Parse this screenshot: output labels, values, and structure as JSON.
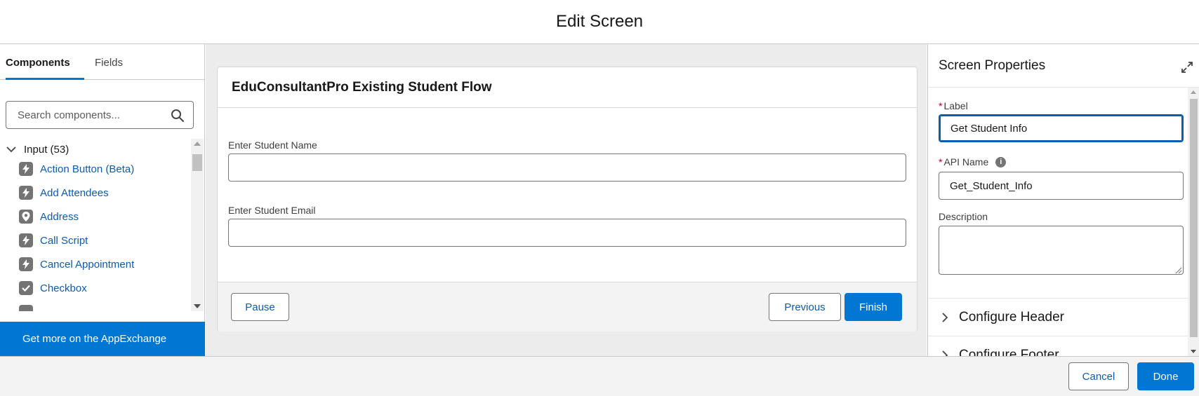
{
  "modal": {
    "title": "Edit Screen"
  },
  "left_panel": {
    "tabs": [
      {
        "label": "Components",
        "active": true
      },
      {
        "label": "Fields",
        "active": false
      }
    ],
    "search": {
      "placeholder": "Search components..."
    },
    "group": {
      "label": "Input (53)",
      "expanded": true
    },
    "components": [
      {
        "label": "Action Button (Beta)",
        "icon": "lightning-icon"
      },
      {
        "label": "Add Attendees",
        "icon": "lightning-icon"
      },
      {
        "label": "Address",
        "icon": "location-pin-icon"
      },
      {
        "label": "Call Script",
        "icon": "lightning-icon"
      },
      {
        "label": "Cancel Appointment",
        "icon": "lightning-icon"
      },
      {
        "label": "Checkbox",
        "icon": "checkbox-icon"
      }
    ],
    "appexchange_label": "Get more on the AppExchange"
  },
  "canvas": {
    "flow_title": "EduConsultantPro Existing Student Flow",
    "fields": [
      {
        "label": "Enter Student Name",
        "value": ""
      },
      {
        "label": "Enter Student Email",
        "value": ""
      }
    ],
    "footer": {
      "pause_label": "Pause",
      "previous_label": "Previous",
      "finish_label": "Finish"
    }
  },
  "properties": {
    "title": "Screen Properties",
    "label_field": {
      "label": "Label",
      "value": "Get Student Info",
      "required": true
    },
    "api_name_field": {
      "label": "API Name",
      "value": "Get_Student_Info",
      "required": true
    },
    "description_field": {
      "label": "Description",
      "value": ""
    },
    "sections": [
      {
        "label": "Configure Header"
      },
      {
        "label": "Configure Footer"
      }
    ]
  },
  "footer": {
    "cancel_label": "Cancel",
    "done_label": "Done"
  },
  "colors": {
    "brand": "#0176d3",
    "link": "#0b5cab",
    "required": "#ba0517",
    "icon_gray": "#747474"
  }
}
